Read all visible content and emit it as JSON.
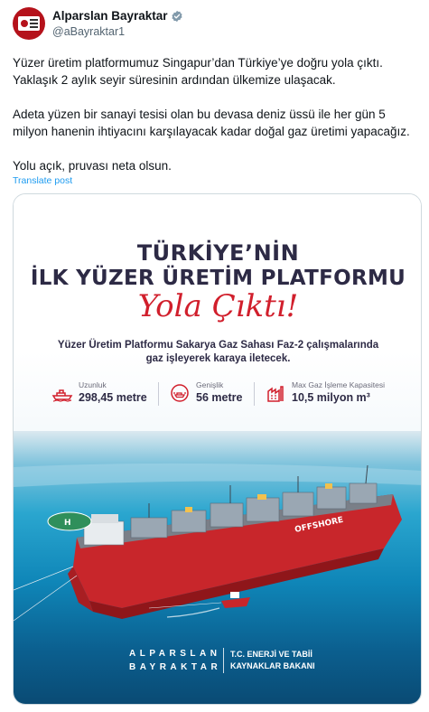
{
  "author": {
    "display_name": "Alparslan Bayraktar",
    "handle": "@aBayraktar1",
    "avatar_icon": "avatar-photo",
    "verified_icon": "verified-badge-icon"
  },
  "tweet": {
    "lines": [
      "Yüzer üretim platformumuz Singapur’dan Türkiye’ye doğru yola çıktı.",
      "Yaklaşık 2 aylık seyir süresinin ardından ülkemize ulaşacak.",
      "Adeta yüzen bir sanayi tesisi olan bu devasa deniz üssü ile her gün 5",
      "milyon hanenin ihtiyacını karşılayacak kadar doğal gaz üretimi yapacağız.",
      "Yolu açık, pruvası neta olsun."
    ],
    "translate_label": "Translate post"
  },
  "poster": {
    "headline_1": "TÜRKİYE’NİN",
    "headline_2": "İLK YÜZER ÜRETİM PLATFORMU",
    "script": "Yola Çıktı!",
    "lead_1": "Yüzer Üretim Platformu Sakarya Gaz Sahası Faz-2 çalışmalarında",
    "lead_2": "gaz işleyerek karaya iletecek.",
    "stats": [
      {
        "label": "Uzunluk",
        "value": "298,45 metre",
        "icon": "ship-length-icon"
      },
      {
        "label": "Genişlik",
        "value": "56 metre",
        "icon": "ship-width-icon"
      },
      {
        "label": "Max Gaz İşleme Kapasitesi",
        "value": "10,5 milyon m³",
        "icon": "gas-capacity-icon"
      }
    ],
    "ship_label": "OFFSHORE",
    "brand_line_1": "ALPARSLAN",
    "brand_line_2": "BAYRAKTAR",
    "title_line_1": "T.C. ENERJİ VE TABİİ",
    "title_line_2": "KAYNAKLAR BAKANI",
    "colors": {
      "accent_red": "#d11f2c",
      "navy": "#2d2a45",
      "sea": "#0f86b8"
    }
  }
}
